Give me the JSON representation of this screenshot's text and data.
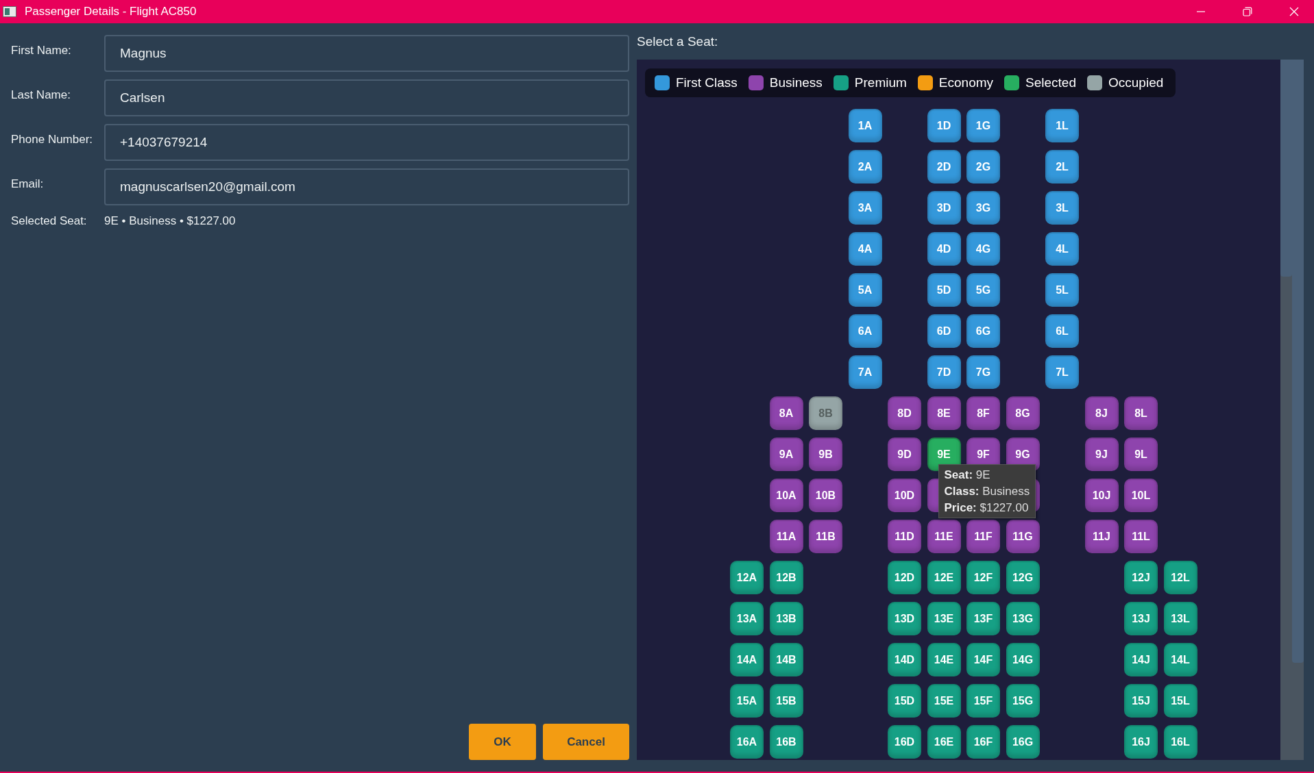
{
  "window": {
    "title": "Passenger Details - Flight AC850"
  },
  "form": {
    "fields": [
      {
        "label": "First Name:",
        "value": "Magnus"
      },
      {
        "label": "Last Name:",
        "value": "Carlsen"
      },
      {
        "label": "Phone Number:",
        "value": "+14037679214"
      },
      {
        "label": "Email:",
        "value": "magnuscarlsen20@gmail.com"
      }
    ],
    "selected_seat": {
      "label": "Selected Seat:",
      "value": "9E • Business • $1227.00"
    }
  },
  "buttons": [
    "OK",
    "Cancel"
  ],
  "seat_map": {
    "title": "Select a Seat:",
    "legend": [
      {
        "label": "First Class",
        "color": "#3498db",
        "kind": "first"
      },
      {
        "label": "Business",
        "color": "#8e44ad",
        "kind": "business"
      },
      {
        "label": "Premium",
        "color": "#16a085",
        "kind": "premium"
      },
      {
        "label": "Economy",
        "color": "#f39c12",
        "kind": "economy"
      },
      {
        "label": "Selected",
        "color": "#27ae60",
        "kind": "selected"
      },
      {
        "label": "Occupied",
        "color": "#95a5a6",
        "kind": "occupied"
      }
    ],
    "rows": [
      {
        "seats": [
          {
            "kind": "space"
          },
          {
            "kind": "space"
          },
          {
            "kind": "space"
          },
          {
            "kind": "first",
            "label": "1A",
            "selected": false,
            "occupied": false
          },
          {
            "kind": "space"
          },
          {
            "kind": "first",
            "label": "1D",
            "selected": false,
            "occupied": false
          },
          {
            "kind": "first",
            "label": "1G",
            "selected": false,
            "occupied": false
          },
          {
            "kind": "space"
          },
          {
            "kind": "first",
            "label": "1L",
            "selected": false,
            "occupied": false
          }
        ]
      },
      {
        "seats": [
          {
            "kind": "space"
          },
          {
            "kind": "space"
          },
          {
            "kind": "space"
          },
          {
            "kind": "first",
            "label": "2A",
            "selected": false,
            "occupied": false
          },
          {
            "kind": "space"
          },
          {
            "kind": "first",
            "label": "2D",
            "selected": false,
            "occupied": false
          },
          {
            "kind": "first",
            "label": "2G",
            "selected": false,
            "occupied": false
          },
          {
            "kind": "space"
          },
          {
            "kind": "first",
            "label": "2L",
            "selected": false,
            "occupied": false
          }
        ]
      },
      {
        "seats": [
          {
            "kind": "space"
          },
          {
            "kind": "space"
          },
          {
            "kind": "space"
          },
          {
            "kind": "first",
            "label": "3A",
            "selected": false,
            "occupied": false
          },
          {
            "kind": "space"
          },
          {
            "kind": "first",
            "label": "3D",
            "selected": false,
            "occupied": false
          },
          {
            "kind": "first",
            "label": "3G",
            "selected": false,
            "occupied": false
          },
          {
            "kind": "space"
          },
          {
            "kind": "first",
            "label": "3L",
            "selected": false,
            "occupied": false
          }
        ]
      },
      {
        "seats": [
          {
            "kind": "space"
          },
          {
            "kind": "space"
          },
          {
            "kind": "space"
          },
          {
            "kind": "first",
            "label": "4A",
            "selected": false,
            "occupied": false
          },
          {
            "kind": "space"
          },
          {
            "kind": "first",
            "label": "4D",
            "selected": false,
            "occupied": false
          },
          {
            "kind": "first",
            "label": "4G",
            "selected": false,
            "occupied": false
          },
          {
            "kind": "space"
          },
          {
            "kind": "first",
            "label": "4L",
            "selected": false,
            "occupied": false
          }
        ]
      },
      {
        "seats": [
          {
            "kind": "space"
          },
          {
            "kind": "space"
          },
          {
            "kind": "space"
          },
          {
            "kind": "first",
            "label": "5A",
            "selected": false,
            "occupied": false
          },
          {
            "kind": "space"
          },
          {
            "kind": "first",
            "label": "5D",
            "selected": false,
            "occupied": false
          },
          {
            "kind": "first",
            "label": "5G",
            "selected": false,
            "occupied": false
          },
          {
            "kind": "space"
          },
          {
            "kind": "first",
            "label": "5L",
            "selected": false,
            "occupied": false
          }
        ]
      },
      {
        "seats": [
          {
            "kind": "space"
          },
          {
            "kind": "space"
          },
          {
            "kind": "space"
          },
          {
            "kind": "first",
            "label": "6A",
            "selected": false,
            "occupied": false
          },
          {
            "kind": "space"
          },
          {
            "kind": "first",
            "label": "6D",
            "selected": false,
            "occupied": false
          },
          {
            "kind": "first",
            "label": "6G",
            "selected": false,
            "occupied": false
          },
          {
            "kind": "space"
          },
          {
            "kind": "first",
            "label": "6L",
            "selected": false,
            "occupied": false
          }
        ]
      },
      {
        "seats": [
          {
            "kind": "space"
          },
          {
            "kind": "space"
          },
          {
            "kind": "space"
          },
          {
            "kind": "first",
            "label": "7A",
            "selected": false,
            "occupied": false
          },
          {
            "kind": "space"
          },
          {
            "kind": "first",
            "label": "7D",
            "selected": false,
            "occupied": false
          },
          {
            "kind": "first",
            "label": "7G",
            "selected": false,
            "occupied": false
          },
          {
            "kind": "space"
          },
          {
            "kind": "first",
            "label": "7L",
            "selected": false,
            "occupied": false
          }
        ]
      },
      {
        "seats": [
          {
            "kind": "space"
          },
          {
            "kind": "business",
            "label": "8A",
            "selected": false,
            "occupied": false
          },
          {
            "kind": "seat",
            "label": "8B",
            "selected": false,
            "occupied": true
          },
          {
            "kind": "space"
          },
          {
            "kind": "business",
            "label": "8D",
            "selected": false,
            "occupied": false
          },
          {
            "kind": "business",
            "label": "8E",
            "selected": false,
            "occupied": false
          },
          {
            "kind": "business",
            "label": "8F",
            "selected": false,
            "occupied": false
          },
          {
            "kind": "business",
            "label": "8G",
            "selected": false,
            "occupied": false
          },
          {
            "kind": "space"
          },
          {
            "kind": "business",
            "label": "8J",
            "selected": false,
            "occupied": false
          },
          {
            "kind": "business",
            "label": "8L",
            "selected": false,
            "occupied": false
          }
        ]
      },
      {
        "seats": [
          {
            "kind": "space"
          },
          {
            "kind": "business",
            "label": "9A",
            "selected": false,
            "occupied": false
          },
          {
            "kind": "business",
            "label": "9B",
            "selected": false,
            "occupied": false
          },
          {
            "kind": "space"
          },
          {
            "kind": "business",
            "label": "9D",
            "selected": false,
            "occupied": false
          },
          {
            "kind": "seat",
            "label": "9E",
            "selected": true,
            "occupied": false,
            "tooltip": [
              "**Seat:** 9E",
              "**Class:** Business",
              "**Price:** $1227.00"
            ]
          },
          {
            "kind": "business",
            "label": "9F",
            "selected": false,
            "occupied": false
          },
          {
            "kind": "business",
            "label": "9G",
            "selected": false,
            "occupied": false
          },
          {
            "kind": "space"
          },
          {
            "kind": "business",
            "label": "9J",
            "selected": false,
            "occupied": false
          },
          {
            "kind": "business",
            "label": "9L",
            "selected": false,
            "occupied": false
          }
        ]
      },
      {
        "seats": [
          {
            "kind": "space"
          },
          {
            "kind": "business",
            "label": "10A",
            "selected": false,
            "occupied": false
          },
          {
            "kind": "business",
            "label": "10B",
            "selected": false,
            "occupied": false
          },
          {
            "kind": "space"
          },
          {
            "kind": "business",
            "label": "10D",
            "selected": false,
            "occupied": false
          },
          {
            "kind": "business"
          },
          {
            "kind": "space"
          },
          {
            "kind": "business"
          },
          {
            "kind": "space"
          },
          {
            "kind": "business",
            "label": "10J",
            "selected": false,
            "occupied": false
          },
          {
            "kind": "business",
            "label": "10L",
            "selected": false,
            "occupied": false
          }
        ]
      },
      {
        "seats": [
          {
            "kind": "space"
          },
          {
            "kind": "business",
            "label": "11A",
            "selected": false,
            "occupied": false
          },
          {
            "kind": "business",
            "label": "11B",
            "selected": false,
            "occupied": false
          },
          {
            "kind": "space"
          },
          {
            "kind": "business",
            "label": "11D",
            "selected": false,
            "occupied": false
          },
          {
            "kind": "business",
            "label": "11E",
            "selected": false,
            "occupied": false
          },
          {
            "kind": "business",
            "label": "11F",
            "selected": false,
            "occupied": false
          },
          {
            "kind": "business",
            "label": "11G",
            "selected": false,
            "occupied": false
          },
          {
            "kind": "space"
          },
          {
            "kind": "business",
            "label": "11J",
            "selected": false,
            "occupied": false
          },
          {
            "kind": "business",
            "label": "11L",
            "selected": false,
            "occupied": false
          }
        ]
      },
      {
        "seats": [
          {
            "kind": "premium",
            "label": "12A",
            "selected": false,
            "occupied": false
          },
          {
            "kind": "premium",
            "label": "12B",
            "selected": false,
            "occupied": false
          },
          {
            "kind": "space"
          },
          {
            "kind": "space"
          },
          {
            "kind": "premium",
            "label": "12D",
            "selected": false,
            "occupied": false
          },
          {
            "kind": "premium",
            "label": "12E",
            "selected": false,
            "occupied": false
          },
          {
            "kind": "premium",
            "label": "12F",
            "selected": false,
            "occupied": false
          },
          {
            "kind": "premium",
            "label": "12G",
            "selected": false,
            "occupied": false
          },
          {
            "kind": "space"
          },
          {
            "kind": "space"
          },
          {
            "kind": "premium",
            "label": "12J",
            "selected": false,
            "occupied": false
          },
          {
            "kind": "premium",
            "label": "12L",
            "selected": false,
            "occupied": false
          }
        ]
      },
      {
        "seats": [
          {
            "kind": "premium",
            "label": "13A",
            "selected": false,
            "occupied": false
          },
          {
            "kind": "premium",
            "label": "13B",
            "selected": false,
            "occupied": false
          },
          {
            "kind": "space"
          },
          {
            "kind": "space"
          },
          {
            "kind": "premium",
            "label": "13D",
            "selected": false,
            "occupied": false
          },
          {
            "kind": "premium",
            "label": "13E",
            "selected": false,
            "occupied": false
          },
          {
            "kind": "premium",
            "label": "13F",
            "selected": false,
            "occupied": false
          },
          {
            "kind": "premium",
            "label": "13G",
            "selected": false,
            "occupied": false
          },
          {
            "kind": "space"
          },
          {
            "kind": "space"
          },
          {
            "kind": "premium",
            "label": "13J",
            "selected": false,
            "occupied": false
          },
          {
            "kind": "premium",
            "label": "13L",
            "selected": false,
            "occupied": false
          }
        ]
      },
      {
        "seats": [
          {
            "kind": "premium",
            "label": "14A",
            "selected": false,
            "occupied": false
          },
          {
            "kind": "premium",
            "label": "14B",
            "selected": false,
            "occupied": false
          },
          {
            "kind": "space"
          },
          {
            "kind": "space"
          },
          {
            "kind": "premium",
            "label": "14D",
            "selected": false,
            "occupied": false
          },
          {
            "kind": "premium",
            "label": "14E",
            "selected": false,
            "occupied": false
          },
          {
            "kind": "premium",
            "label": "14F",
            "selected": false,
            "occupied": false
          },
          {
            "kind": "premium",
            "label": "14G",
            "selected": false,
            "occupied": false
          },
          {
            "kind": "space"
          },
          {
            "kind": "space"
          },
          {
            "kind": "premium",
            "label": "14J",
            "selected": false,
            "occupied": false
          },
          {
            "kind": "premium",
            "label": "14L",
            "selected": false,
            "occupied": false
          }
        ]
      },
      {
        "seats": [
          {
            "kind": "premium",
            "label": "15A",
            "selected": false,
            "occupied": false
          },
          {
            "kind": "premium",
            "label": "15B",
            "selected": false,
            "occupied": false
          },
          {
            "kind": "space"
          },
          {
            "kind": "space"
          },
          {
            "kind": "premium",
            "label": "15D",
            "selected": false,
            "occupied": false
          },
          {
            "kind": "premium",
            "label": "15E",
            "selected": false,
            "occupied": false
          },
          {
            "kind": "premium",
            "label": "15F",
            "selected": false,
            "occupied": false
          },
          {
            "kind": "premium",
            "label": "15G",
            "selected": false,
            "occupied": false
          },
          {
            "kind": "space"
          },
          {
            "kind": "space"
          },
          {
            "kind": "premium",
            "label": "15J",
            "selected": false,
            "occupied": false
          },
          {
            "kind": "premium",
            "label": "15L",
            "selected": false,
            "occupied": false
          }
        ]
      },
      {
        "seats": [
          {
            "kind": "premium",
            "label": "16A",
            "selected": false,
            "occupied": false
          },
          {
            "kind": "premium",
            "label": "16B",
            "selected": false,
            "occupied": false
          },
          {
            "kind": "space"
          },
          {
            "kind": "space"
          },
          {
            "kind": "premium",
            "label": "16D",
            "selected": false,
            "occupied": false
          },
          {
            "kind": "premium",
            "label": "16E",
            "selected": false,
            "occupied": false
          },
          {
            "kind": "premium",
            "label": "16F",
            "selected": false,
            "occupied": false
          },
          {
            "kind": "premium",
            "label": "16G",
            "selected": false,
            "occupied": false
          },
          {
            "kind": "space"
          },
          {
            "kind": "space"
          },
          {
            "kind": "premium",
            "label": "16J",
            "selected": false,
            "occupied": false
          },
          {
            "kind": "premium",
            "label": "16L",
            "selected": false,
            "occupied": false
          }
        ]
      }
    ]
  }
}
